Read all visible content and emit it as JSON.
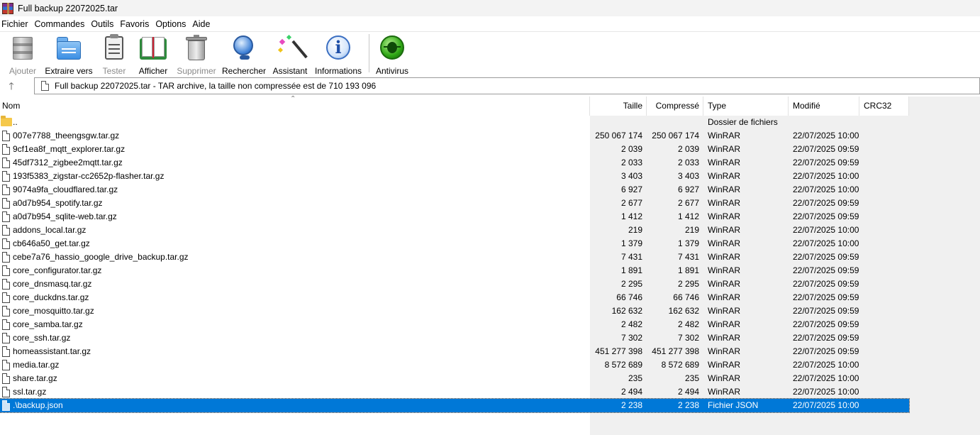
{
  "window": {
    "title": "Full backup 22072025.tar"
  },
  "menu": [
    "Fichier",
    "Commandes",
    "Outils",
    "Favoris",
    "Options",
    "Aide"
  ],
  "toolbar": [
    {
      "label": "Ajouter",
      "icon": "add-archive-icon",
      "enabled": false
    },
    {
      "label": "Extraire vers",
      "icon": "extract-folder-icon",
      "enabled": true
    },
    {
      "label": "Tester",
      "icon": "test-clipboard-icon",
      "enabled": false
    },
    {
      "label": "Afficher",
      "icon": "view-book-icon",
      "enabled": true
    },
    {
      "label": "Supprimer",
      "icon": "trash-icon",
      "enabled": false
    },
    {
      "label": "Rechercher",
      "icon": "magnifier-icon",
      "enabled": true
    },
    {
      "label": "Assistant",
      "icon": "magic-wand-icon",
      "enabled": true
    },
    {
      "label": "Informations",
      "icon": "info-icon",
      "enabled": true
    },
    {
      "label": "Antivirus",
      "icon": "antivirus-bug-icon",
      "enabled": true
    }
  ],
  "address": {
    "text": "Full backup 22072025.tar - TAR archive, la taille non compressée est de 710 193 096"
  },
  "columns": {
    "name": "Nom",
    "size": "Taille",
    "compressed": "Compressé",
    "type": "Type",
    "modified": "Modifié",
    "crc": "CRC32"
  },
  "parent_row": {
    "name": "..",
    "type": "Dossier de fichiers"
  },
  "files": [
    {
      "name": "007e7788_theengsgw.tar.gz",
      "size": "250 067 174",
      "compressed": "250 067 174",
      "type": "WinRAR",
      "modified": "22/07/2025 10:00"
    },
    {
      "name": "9cf1ea8f_mqtt_explorer.tar.gz",
      "size": "2 039",
      "compressed": "2 039",
      "type": "WinRAR",
      "modified": "22/07/2025 09:59"
    },
    {
      "name": "45df7312_zigbee2mqtt.tar.gz",
      "size": "2 033",
      "compressed": "2 033",
      "type": "WinRAR",
      "modified": "22/07/2025 09:59"
    },
    {
      "name": "193f5383_zigstar-cc2652p-flasher.tar.gz",
      "size": "3 403",
      "compressed": "3 403",
      "type": "WinRAR",
      "modified": "22/07/2025 10:00"
    },
    {
      "name": "9074a9fa_cloudflared.tar.gz",
      "size": "6 927",
      "compressed": "6 927",
      "type": "WinRAR",
      "modified": "22/07/2025 10:00"
    },
    {
      "name": "a0d7b954_spotify.tar.gz",
      "size": "2 677",
      "compressed": "2 677",
      "type": "WinRAR",
      "modified": "22/07/2025 09:59"
    },
    {
      "name": "a0d7b954_sqlite-web.tar.gz",
      "size": "1 412",
      "compressed": "1 412",
      "type": "WinRAR",
      "modified": "22/07/2025 09:59"
    },
    {
      "name": "addons_local.tar.gz",
      "size": "219",
      "compressed": "219",
      "type": "WinRAR",
      "modified": "22/07/2025 10:00"
    },
    {
      "name": "cb646a50_get.tar.gz",
      "size": "1 379",
      "compressed": "1 379",
      "type": "WinRAR",
      "modified": "22/07/2025 10:00"
    },
    {
      "name": "cebe7a76_hassio_google_drive_backup.tar.gz",
      "size": "7 431",
      "compressed": "7 431",
      "type": "WinRAR",
      "modified": "22/07/2025 09:59"
    },
    {
      "name": "core_configurator.tar.gz",
      "size": "1 891",
      "compressed": "1 891",
      "type": "WinRAR",
      "modified": "22/07/2025 09:59"
    },
    {
      "name": "core_dnsmasq.tar.gz",
      "size": "2 295",
      "compressed": "2 295",
      "type": "WinRAR",
      "modified": "22/07/2025 09:59"
    },
    {
      "name": "core_duckdns.tar.gz",
      "size": "66 746",
      "compressed": "66 746",
      "type": "WinRAR",
      "modified": "22/07/2025 09:59"
    },
    {
      "name": "core_mosquitto.tar.gz",
      "size": "162 632",
      "compressed": "162 632",
      "type": "WinRAR",
      "modified": "22/07/2025 09:59"
    },
    {
      "name": "core_samba.tar.gz",
      "size": "2 482",
      "compressed": "2 482",
      "type": "WinRAR",
      "modified": "22/07/2025 09:59"
    },
    {
      "name": "core_ssh.tar.gz",
      "size": "7 302",
      "compressed": "7 302",
      "type": "WinRAR",
      "modified": "22/07/2025 09:59"
    },
    {
      "name": "homeassistant.tar.gz",
      "size": "451 277 398",
      "compressed": "451 277 398",
      "type": "WinRAR",
      "modified": "22/07/2025 09:59"
    },
    {
      "name": "media.tar.gz",
      "size": "8 572 689",
      "compressed": "8 572 689",
      "type": "WinRAR",
      "modified": "22/07/2025 10:00"
    },
    {
      "name": "share.tar.gz",
      "size": "235",
      "compressed": "235",
      "type": "WinRAR",
      "modified": "22/07/2025 10:00"
    },
    {
      "name": "ssl.tar.gz",
      "size": "2 494",
      "compressed": "2 494",
      "type": "WinRAR",
      "modified": "22/07/2025 10:00"
    },
    {
      "name": ".\\backup.json",
      "size": "2 238",
      "compressed": "2 238",
      "type": "Fichier JSON",
      "modified": "22/07/2025 10:00",
      "selected": true
    }
  ],
  "colors": {
    "selection": "#0078d7",
    "listRight": "#f0f0f0"
  }
}
